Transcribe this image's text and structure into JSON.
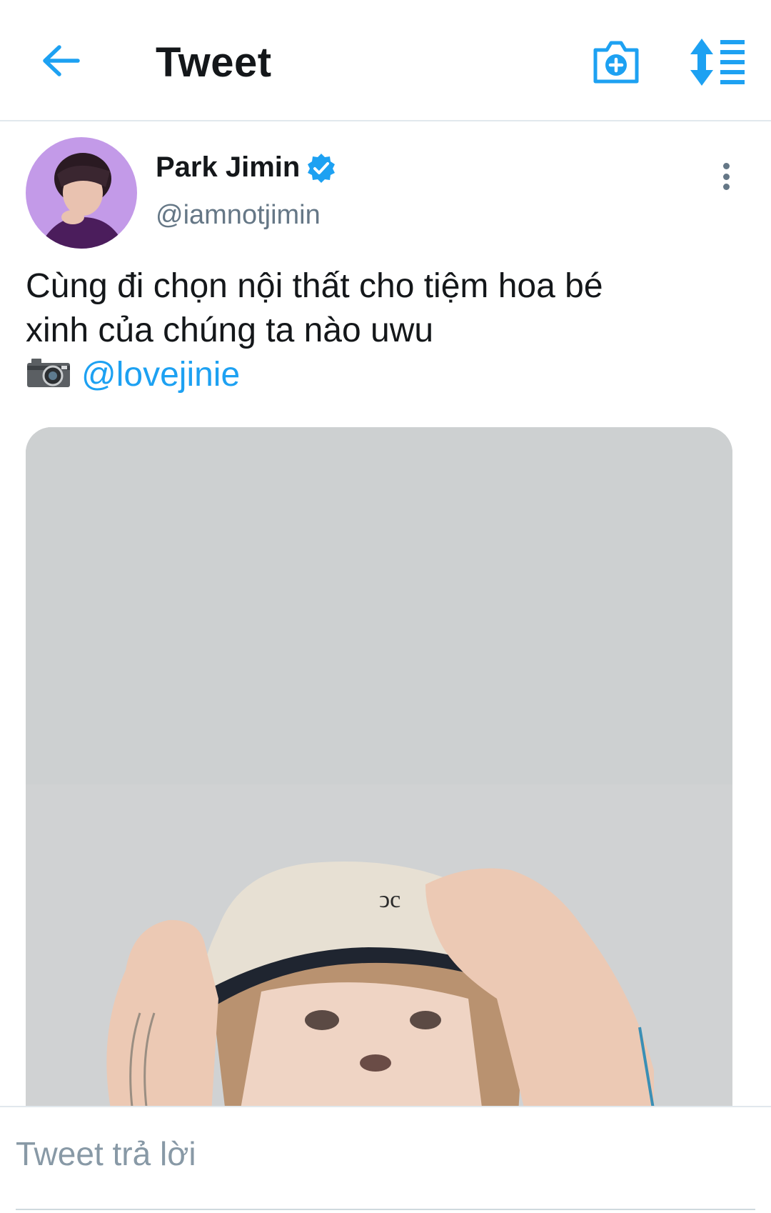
{
  "header": {
    "title": "Tweet",
    "icons": [
      "back-arrow-icon",
      "camera-plus-icon",
      "sort-lines-icon"
    ]
  },
  "tweet": {
    "author": {
      "display_name": "Park Jimin",
      "handle": "@iamnotjimin",
      "verified": true
    },
    "text_line1": "Cùng đi chọn nội thất cho tiệm hoa bé",
    "text_line2": "xinh của chúng ta nào uwu",
    "photo_credit_emoji": "camera-emoji",
    "mention": "@lovejinie",
    "media": "photo"
  },
  "reply": {
    "placeholder": "Tweet trả lời"
  },
  "colors": {
    "accent": "#1da1f2",
    "text_primary": "#14171a",
    "text_secondary": "#657786",
    "divider": "#e1e8ed",
    "avatar_bg": "#b58be0"
  }
}
